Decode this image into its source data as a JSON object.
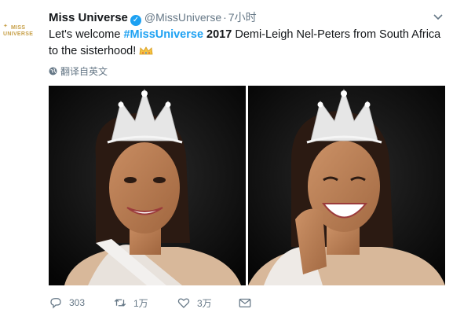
{
  "tweet": {
    "avatar": {
      "line1": "MISS",
      "line2": "UNIVERSE"
    },
    "author_name": "Miss Universe",
    "verified_mark": "✓",
    "handle": "@MissUniverse",
    "separator": "·",
    "time": "7小时",
    "text_part1": "Let's welcome ",
    "hashtag": "#MissUniverse",
    "text_part2": " 2017",
    "text_part3": " Demi-Leigh Nel-Peters from South Africa to the sisterhood!",
    "translate_label": "翻译自英文",
    "reply_count": "303",
    "retweet_count": "1万",
    "like_count": "3万"
  },
  "icons": {
    "more": "chevron-down-icon",
    "crown": "crown-emoji",
    "translate": "globe-icon",
    "reply": "reply-icon",
    "retweet": "retweet-icon",
    "like": "heart-icon",
    "dm": "envelope-icon"
  },
  "colors": {
    "link": "#1da1f2",
    "muted": "#657786",
    "text": "#14171a",
    "brand_gold": "#c8a14a"
  }
}
